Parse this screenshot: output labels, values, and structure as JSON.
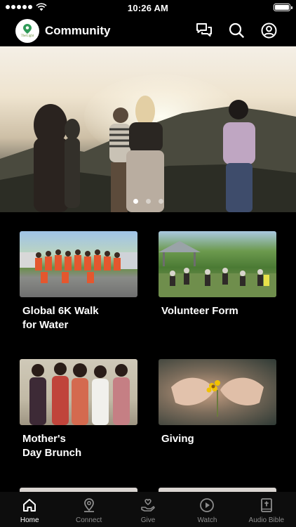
{
  "status_bar": {
    "time": "10:26 AM"
  },
  "header": {
    "title": "Community",
    "logo_text": "TheLight"
  },
  "hero": {
    "slide_count": 3,
    "active_slide": 1
  },
  "cards": [
    {
      "title": "Global 6K Walk\nfor Water"
    },
    {
      "title": "Volunteer Form"
    },
    {
      "title": "Mother's\nDay Brunch"
    },
    {
      "title": "Giving"
    }
  ],
  "tabs": [
    {
      "label": "Home",
      "icon": "home-icon",
      "active": true
    },
    {
      "label": "Connect",
      "icon": "map-pin-icon"
    },
    {
      "label": "Give",
      "icon": "giving-hand-icon"
    },
    {
      "label": "Watch",
      "icon": "play-circle-icon"
    },
    {
      "label": "Audio Bible",
      "icon": "bible-icon"
    }
  ]
}
